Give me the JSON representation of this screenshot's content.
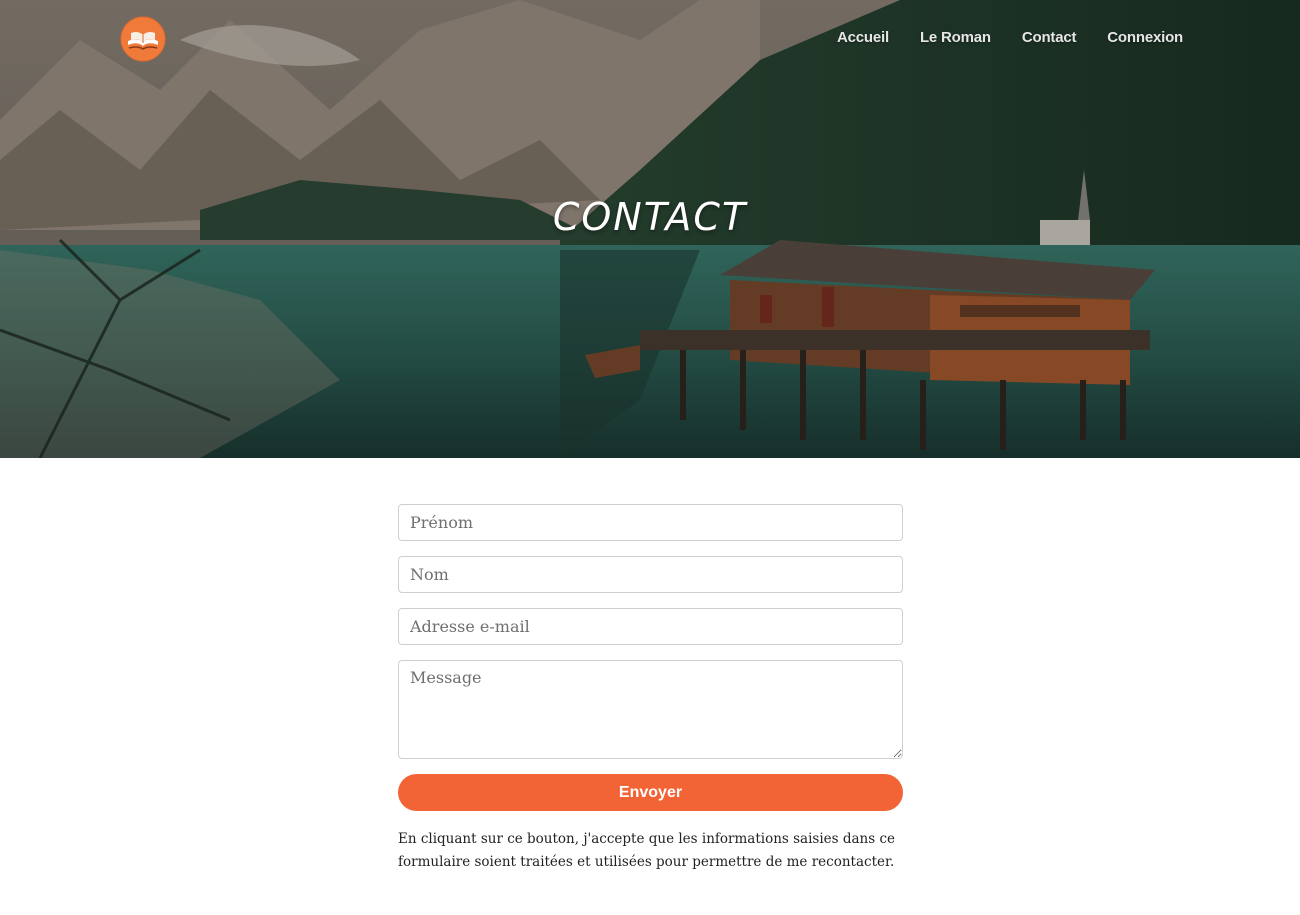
{
  "header": {
    "logo_icon": "open-book-icon",
    "nav": [
      {
        "label": "Accueil"
      },
      {
        "label": "Le Roman"
      },
      {
        "label": "Contact"
      },
      {
        "label": "Connexion"
      }
    ]
  },
  "hero": {
    "title": "CONTACT"
  },
  "form": {
    "first_name_placeholder": "Prénom",
    "last_name_placeholder": "Nom",
    "email_placeholder": "Adresse e-mail",
    "message_placeholder": "Message",
    "submit_label": "Envoyer",
    "consent_text": "En cliquant sur ce bouton, j'accepte que les informations saisies dans ce formulaire soient traitées et utilisées pour permettre de me recontacter."
  },
  "colors": {
    "accent": "#f26436",
    "logo_bg": "#f07a3a"
  }
}
